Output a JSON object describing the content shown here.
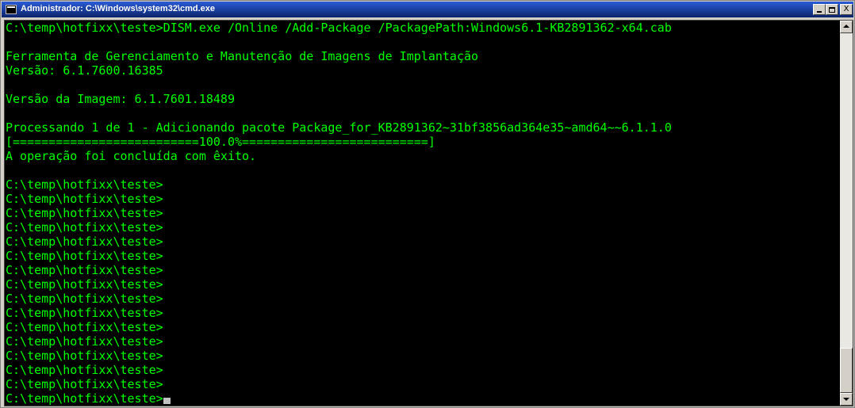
{
  "window": {
    "title": "Administrador: C:\\Windows\\system32\\cmd.exe",
    "controls": {
      "minimize": "_",
      "maximize": "□",
      "close": "X"
    }
  },
  "console": {
    "lines": [
      "C:\\temp\\hotfixx\\teste>DISM.exe /Online /Add-Package /PackagePath:Windows6.1-KB2891362-x64.cab",
      "",
      "Ferramenta de Gerenciamento e Manutenção de Imagens de Implantação",
      "Versão: 6.1.7600.16385",
      "",
      "Versão da Imagem: 6.1.7601.18489",
      "",
      "Processando 1 de 1 - Adicionando pacote Package_for_KB2891362~31bf3856ad364e35~amd64~~6.1.1.0",
      "[==========================100.0%==========================]",
      "A operação foi concluída com êxito.",
      "",
      "C:\\temp\\hotfixx\\teste>",
      "C:\\temp\\hotfixx\\teste>",
      "C:\\temp\\hotfixx\\teste>",
      "C:\\temp\\hotfixx\\teste>",
      "C:\\temp\\hotfixx\\teste>",
      "C:\\temp\\hotfixx\\teste>",
      "C:\\temp\\hotfixx\\teste>",
      "C:\\temp\\hotfixx\\teste>",
      "C:\\temp\\hotfixx\\teste>",
      "C:\\temp\\hotfixx\\teste>",
      "C:\\temp\\hotfixx\\teste>",
      "C:\\temp\\hotfixx\\teste>",
      "C:\\temp\\hotfixx\\teste>",
      "C:\\temp\\hotfixx\\teste>",
      "C:\\temp\\hotfixx\\teste>",
      "C:\\temp\\hotfixx\\teste>"
    ],
    "text_color": "#00ff00",
    "background": "#000000"
  }
}
